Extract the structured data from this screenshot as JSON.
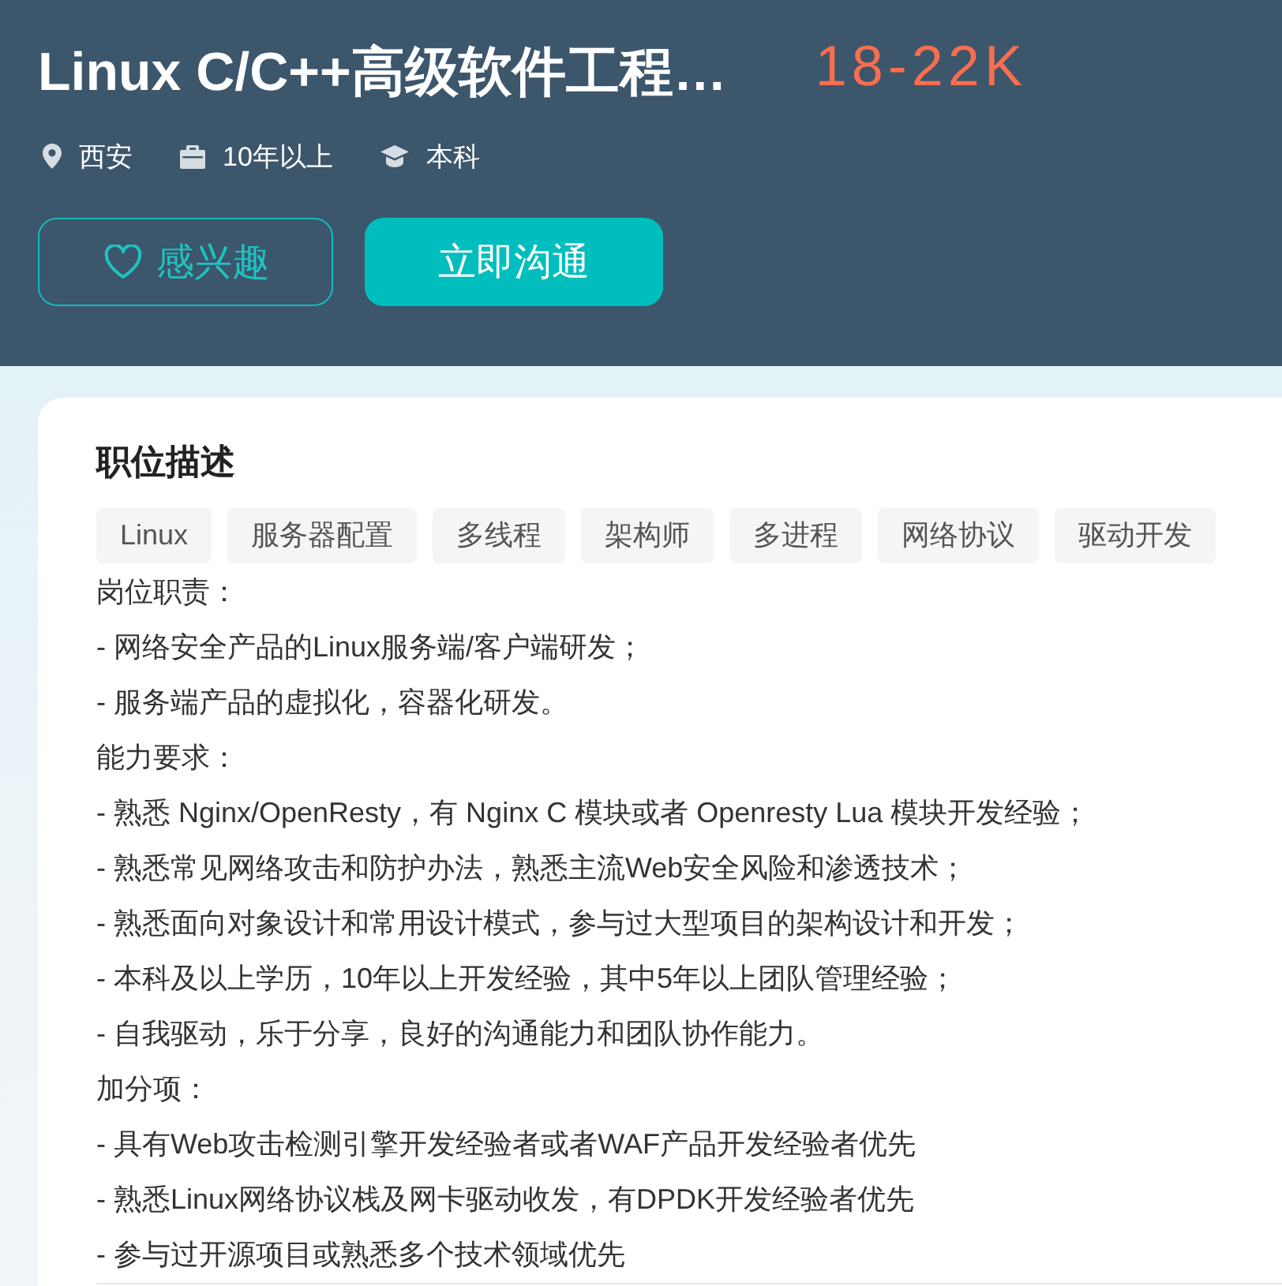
{
  "job": {
    "title": "Linux C/C++高级软件工程…",
    "salary": "18-22K",
    "meta": [
      {
        "kind": "location",
        "text": "西安"
      },
      {
        "kind": "experience",
        "text": "10年以上"
      },
      {
        "kind": "education",
        "text": "本科"
      }
    ],
    "buttons": [
      {
        "kind": "interest",
        "label": "感兴趣"
      },
      {
        "kind": "chat",
        "label": "立即沟通"
      }
    ]
  },
  "description": {
    "title": "职位描述",
    "tags": [
      "Linux",
      "服务器配置",
      "多线程",
      "架构师",
      "多进程",
      "网络协议",
      "驱动开发"
    ],
    "lines": [
      "岗位职责：",
      "- 网络安全产品的Linux服务端/客户端研发；",
      "- 服务端产品的虚拟化，容器化研发。",
      "能力要求：",
      "- 熟悉 Nginx/OpenResty，有 Nginx C 模块或者 Openresty Lua 模块开发经验；",
      "- 熟悉常见网络攻击和防护办法，熟悉主流Web安全风险和渗透技术；",
      "- 熟悉面向对象设计和常用设计模式，参与过大型项目的架构设计和开发；",
      "- 本科及以上学历，10年以上开发经验，其中5年以上团队管理经验；",
      "- 自我驱动，乐于分享，良好的沟通能力和团队协作能力。",
      "加分项：",
      "- 具有Web攻击检测引擎开发经验者或者WAF产品开发经验者优先",
      "- 熟悉Linux网络协议栈及网卡驱动收发，有DPDK开发经验者优先",
      "- 参与过开源项目或熟悉多个技术领域优先"
    ]
  }
}
